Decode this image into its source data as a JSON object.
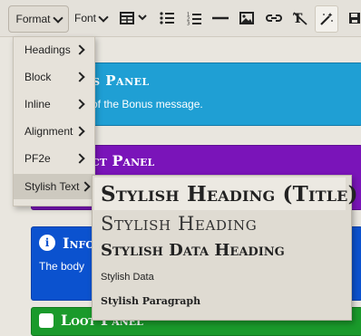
{
  "toolbar": {
    "format_label": "Format",
    "font_label": "Font",
    "icons": [
      "table-icon",
      "chevron-down-icon",
      "bullet-list-icon",
      "numbered-list-icon",
      "horizontal-rule-icon",
      "image-icon",
      "link-icon",
      "clear-formatting-icon",
      "magic-wand-icon",
      "save-icon"
    ]
  },
  "panels": {
    "bonus": {
      "title": "Bonus Panel",
      "title_visible": "us Panel",
      "body": "of the Bonus message."
    },
    "effect": {
      "title_visible": "ct Panel"
    },
    "info": {
      "title_visible": "Info",
      "body": "The body"
    },
    "loot": {
      "title": "Loot Panel"
    }
  },
  "format_menu": {
    "items": [
      {
        "label": "Headings"
      },
      {
        "label": "Block"
      },
      {
        "label": "Inline"
      },
      {
        "label": "Alignment"
      },
      {
        "label": "PF2e"
      },
      {
        "label": "Stylish Text"
      }
    ]
  },
  "stylish_menu": {
    "items": [
      {
        "label": "Stylish Heading (Title)"
      },
      {
        "label": "Stylish Heading"
      },
      {
        "label": "Stylish Data Heading"
      },
      {
        "label": "Stylish Data"
      },
      {
        "label": "Stylish Paragraph"
      }
    ]
  },
  "colors": {
    "bonus": "#1f9fd4",
    "effect": "#7a14b9",
    "info": "#0b52cf",
    "loot": "#1a9a2b"
  }
}
